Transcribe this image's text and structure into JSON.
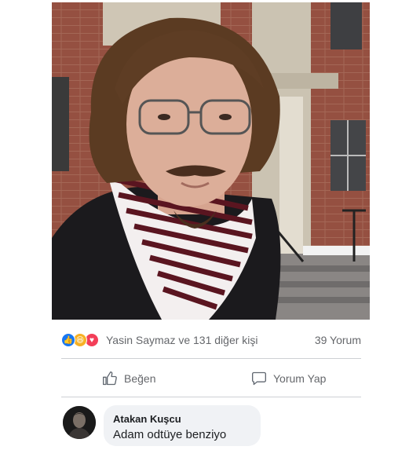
{
  "post": {
    "reaction_summary": "Yasin Saymaz ve 131 diğer kişi",
    "comments_count": "39 Yorum",
    "reaction_icons": [
      "like-icon",
      "haha-icon",
      "love-icon"
    ]
  },
  "actions": {
    "like_label": "Beğen",
    "comment_label": "Yorum Yap"
  },
  "comment": {
    "author": "Atakan Kuşcu",
    "text": "Adam odtüye benziyo"
  },
  "colors": {
    "like_blue": "#1877f2",
    "haha_yellow": "#f7b125",
    "love_red": "#f33e58",
    "bubble_bg": "#f0f2f5"
  }
}
